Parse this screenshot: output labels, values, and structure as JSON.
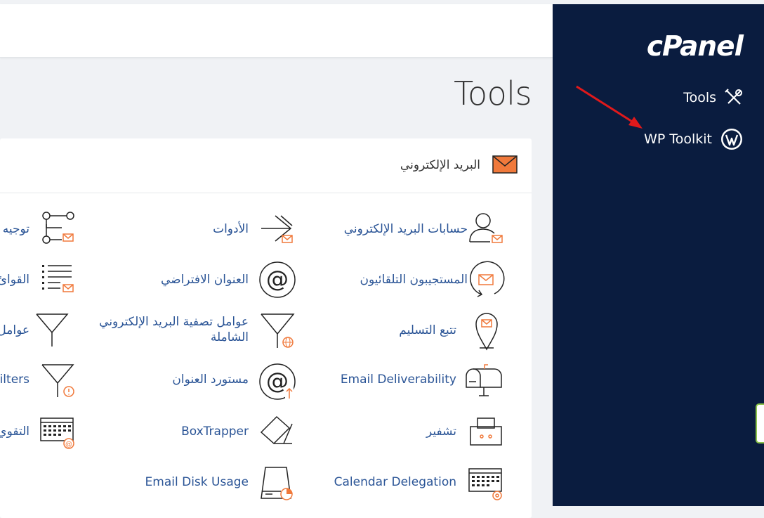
{
  "header": {
    "page_title": "Tools"
  },
  "sidebar": {
    "logo": "cPanel",
    "items": [
      {
        "label": "Tools",
        "icon": "tools-icon"
      },
      {
        "label": "WP Toolkit",
        "icon": "wordpress-icon"
      }
    ]
  },
  "email_section": {
    "title": "البريد الإلكتروني",
    "col1": [
      {
        "label": "حسابات البريد الإلكتروني",
        "icon": "email-accounts-icon"
      },
      {
        "label": "المستجيبون التلقائيون",
        "icon": "autoresponders-icon"
      },
      {
        "label": "تتبع التسليم",
        "icon": "track-delivery-icon"
      },
      {
        "label": "Email Deliverability",
        "icon": "mailbox-icon"
      },
      {
        "label": "تشفير",
        "icon": "encryption-icon"
      },
      {
        "label": "Calendar Delegation",
        "icon": "calendar-delegation-icon"
      }
    ],
    "col2": [
      {
        "label": "الأدوات",
        "icon": "forwarders-icon"
      },
      {
        "label": "العنوان الافتراضي",
        "icon": "default-address-icon"
      },
      {
        "label": "عوامل تصفية البريد الإلكتروني الشاملة",
        "icon": "global-filters-icon"
      },
      {
        "label": "مستورد العنوان",
        "icon": "address-importer-icon"
      },
      {
        "label": "BoxTrapper",
        "icon": "boxtrapper-icon"
      },
      {
        "label": "Email Disk Usage",
        "icon": "disk-usage-icon"
      }
    ],
    "col3": [
      {
        "label": "توجيه",
        "icon": "routing-icon"
      },
      {
        "label": "القوائ",
        "icon": "lists-icon"
      },
      {
        "label": "عوامل",
        "icon": "filters-icon"
      },
      {
        "label": "ilters",
        "icon": "spam-filters-icon"
      },
      {
        "label": "التقوي",
        "icon": "calendar-icon"
      }
    ]
  },
  "colors": {
    "sidebar_bg": "#0a1c3f",
    "link": "#2a5496",
    "accent": "#f0793b",
    "annotation_arrow": "#e0191b"
  }
}
